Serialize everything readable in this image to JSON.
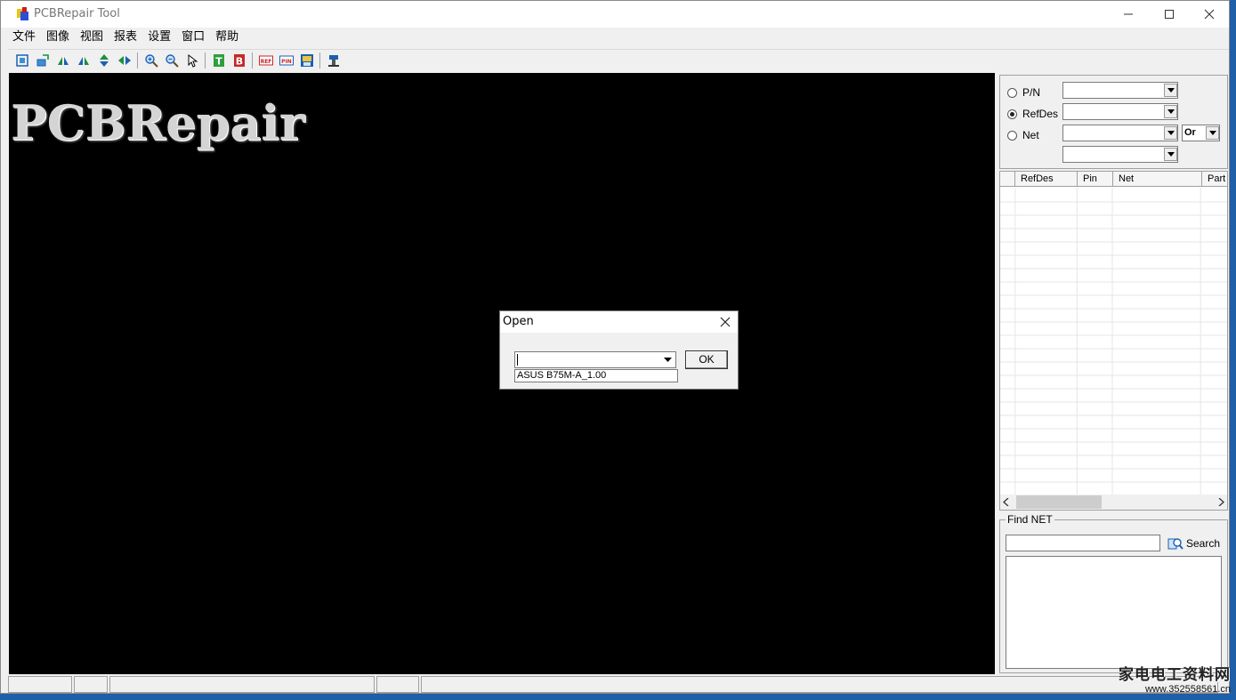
{
  "window": {
    "title": "PCBRepair Tool"
  },
  "menu": [
    "文件",
    "图像",
    "视图",
    "报表",
    "设置",
    "窗口",
    "帮助"
  ],
  "toolbar": {
    "groups": [
      [
        "fit-view-icon",
        "rotate-icon",
        "mirror-top-icon",
        "mirror-bottom-icon",
        "flip-vertical-icon",
        "flip-horizontal-icon"
      ],
      [
        "zoom-in-icon",
        "zoom-out-icon",
        "pointer-icon"
      ],
      [
        "top-layer-icon",
        "bottom-layer-icon"
      ],
      [
        "ref-icon",
        "pin-icon",
        "save-image-icon"
      ],
      [
        "tool-icon"
      ]
    ],
    "top_label": "T",
    "bottom_label": "B",
    "ref_label": "REF",
    "pin_label": "PIN"
  },
  "canvas": {
    "logo": "PCBRepair",
    "background": "#000000"
  },
  "dialog": {
    "title": "Open",
    "combo_value": "",
    "ok_label": "OK",
    "list_item": "ASUS B75M-A_1.00"
  },
  "search_panel": {
    "radios": [
      {
        "label": "P/N",
        "checked": false
      },
      {
        "label": "RefDes",
        "checked": true
      },
      {
        "label": "Net",
        "checked": false
      }
    ],
    "operator": "Or"
  },
  "grid": {
    "columns": [
      "RefDes",
      "Pin",
      "Net",
      "Part"
    ]
  },
  "find_net": {
    "label": "Find NET",
    "search_label": "Search"
  },
  "watermark": {
    "line1": "家电电工资料网",
    "line2": "www.352558561.cn"
  }
}
